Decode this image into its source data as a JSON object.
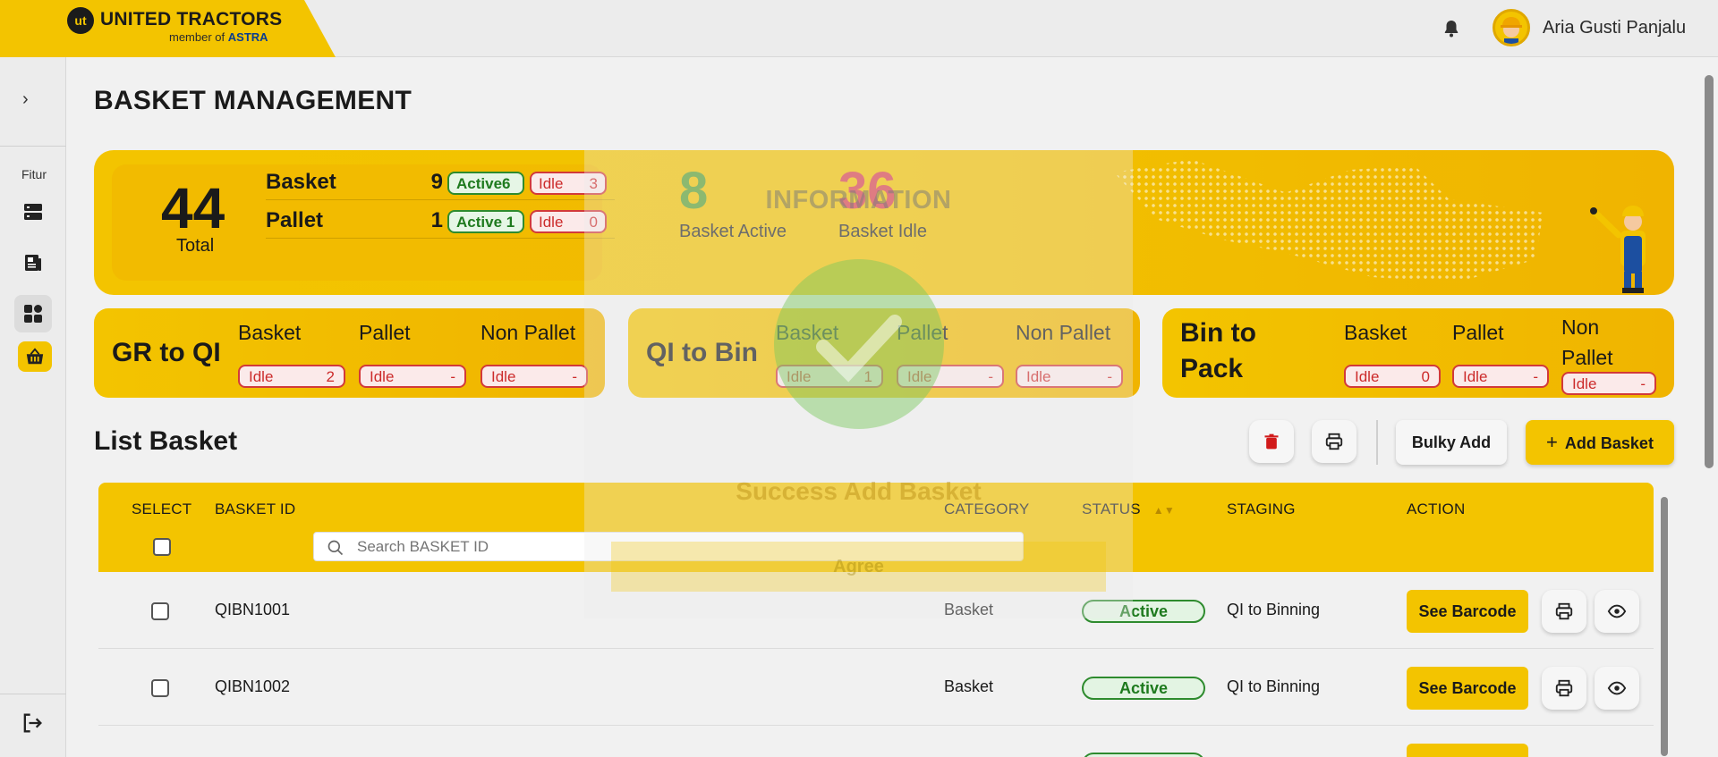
{
  "brand": {
    "name": "UNITED TRACTORS",
    "tagline_prefix": "member of",
    "tagline_brand": "ASTRA",
    "mark": "ut"
  },
  "user": {
    "name": "Aria Gusti Panjalu"
  },
  "sidebar": {
    "section_label": "Fitur",
    "items": [
      {
        "icon": "server-list-icon"
      },
      {
        "icon": "newspaper-icon"
      },
      {
        "icon": "dashboard-grid-icon",
        "active": true
      },
      {
        "icon": "basket-icon",
        "highlight": true
      }
    ]
  },
  "page": {
    "title": "BASKET MANAGEMENT"
  },
  "summary": {
    "total": "44",
    "total_label": "Total",
    "rows": [
      {
        "name": "Basket",
        "count": "9",
        "active_label": "Active",
        "active": "6",
        "idle_label": "Idle",
        "idle": "3"
      },
      {
        "name": "Pallet",
        "count": "1",
        "active_label": "Active",
        "active": "1",
        "idle_label": "Idle",
        "idle": "0"
      }
    ],
    "basket_active": "8",
    "basket_active_label": "Basket Active",
    "basket_idle": "36",
    "basket_idle_label": "Basket Idle"
  },
  "stages": [
    {
      "title": "GR to QI",
      "cols": [
        {
          "label": "Basket",
          "idle": "2"
        },
        {
          "label": "Pallet",
          "idle": "-"
        },
        {
          "label": "Non Pallet",
          "idle": "-"
        }
      ]
    },
    {
      "title": "QI to Bin",
      "cols": [
        {
          "label": "Basket",
          "idle": "1"
        },
        {
          "label": "Pallet",
          "idle": "-"
        },
        {
          "label": "Non Pallet",
          "idle": "-"
        }
      ]
    },
    {
      "title_line1": "Bin to",
      "title_line2": "Pack",
      "cols": [
        {
          "label": "Basket",
          "idle": "0"
        },
        {
          "label": "Pallet",
          "idle": "-"
        },
        {
          "label_line1": "Non",
          "label_line2": "Pallet",
          "idle": "-"
        }
      ]
    }
  ],
  "idle_label": "Idle",
  "list": {
    "title": "List Basket",
    "bulky_label": "Bulky Add",
    "add_label": "Add Basket",
    "columns": {
      "select": "SELECT",
      "id": "BASKET ID",
      "category": "CATEGORY",
      "status": "STATUS",
      "staging": "STAGING",
      "action": "ACTION"
    },
    "search_placeholder": "Search BASKET ID",
    "rows": [
      {
        "id": "QIBN1001",
        "category": "Basket",
        "status": "Active",
        "staging": "QI to Binning",
        "action": "See Barcode"
      },
      {
        "id": "QIBN1002",
        "category": "Basket",
        "status": "Active",
        "staging": "QI to Binning",
        "action": "See Barcode"
      }
    ]
  },
  "modal": {
    "title": "INFORMATION",
    "message": "Success Add Basket",
    "button": "Agree"
  },
  "colors": {
    "brand_yellow": "#f3c400",
    "active_green": "#2e8b2e",
    "idle_red": "#d23a3a",
    "active_stat": "#5a9e2f",
    "idle_stat": "#d9414a"
  }
}
